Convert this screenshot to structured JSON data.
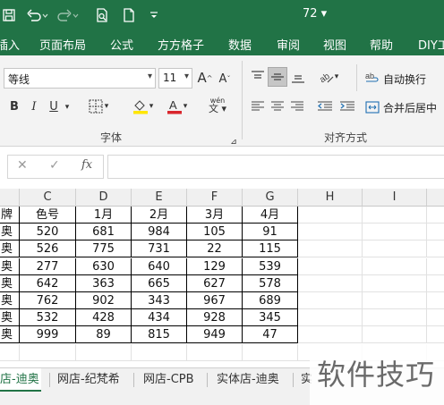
{
  "titlebar": {
    "doc_title": "72 ▾",
    "icons": [
      "save-icon",
      "undo-icon",
      "redo-icon",
      "print-preview-icon",
      "new-document-icon",
      "customize-quick-access-icon"
    ]
  },
  "ribbon_tabs": [
    "插入",
    "页面布局",
    "公式",
    "方方格子",
    "数据",
    "审阅",
    "视图",
    "帮助",
    "DIY工"
  ],
  "font_group": {
    "font_name": "等线",
    "font_size": "11",
    "grow_label": "A",
    "shrink_label": "A",
    "bold": "B",
    "italic": "I",
    "underline": "U",
    "label": "字体",
    "phonetic": "wén"
  },
  "alignment_group": {
    "wrap_text": "自动换行",
    "merge_center": "合并后居中",
    "label": "对齐方式"
  },
  "formula_bar": {
    "cancel": "✕",
    "enter": "✓",
    "fx": "fx",
    "value": ""
  },
  "grid": {
    "columns": [
      "C",
      "D",
      "E",
      "F",
      "G",
      "H",
      "I"
    ],
    "row_prefix": [
      "牌",
      "奥",
      "奥",
      "奥",
      "奥",
      "奥",
      "奥",
      "奥"
    ],
    "header_row": [
      "色号",
      "1月",
      "2月",
      "3月",
      "4月"
    ],
    "rows": [
      [
        "520",
        "681",
        "984",
        "105",
        "91"
      ],
      [
        "526",
        "775",
        "731",
        "22",
        "115"
      ],
      [
        "277",
        "630",
        "640",
        "129",
        "539"
      ],
      [
        "642",
        "363",
        "665",
        "627",
        "578"
      ],
      [
        "762",
        "902",
        "343",
        "967",
        "689"
      ],
      [
        "532",
        "428",
        "434",
        "928",
        "345"
      ],
      [
        "999",
        "89",
        "815",
        "949",
        "47"
      ]
    ]
  },
  "sheet_tabs": [
    "店-迪奥",
    "网店-纪梵希",
    "网店-CPB",
    "实体店-迪奥",
    "实"
  ],
  "watermark": "软件技巧",
  "colors": {
    "brand": "#217346",
    "font_color": "#d9262c",
    "highlight": "#ffe600"
  }
}
